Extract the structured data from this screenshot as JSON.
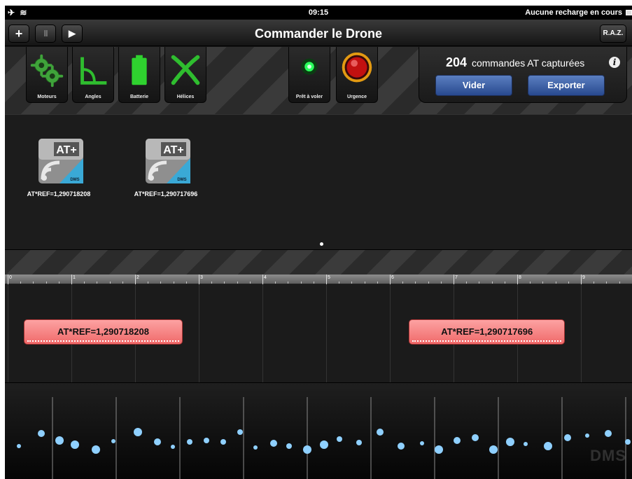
{
  "status": {
    "time": "09:15",
    "charging": "Aucune recharge en cours"
  },
  "nav": {
    "add": "+",
    "pause": "II",
    "play": "▶",
    "title": "Commander le Drone",
    "reset": "R.A.Z."
  },
  "tools": [
    {
      "label": "Moteurs",
      "icon": "gears-icon"
    },
    {
      "label": "Angles",
      "icon": "angle-icon"
    },
    {
      "label": "Batterie",
      "icon": "battery-icon"
    },
    {
      "label": "Hélices",
      "icon": "propeller-icon"
    },
    {
      "label": "Prêt à voler",
      "icon": "ready-light-icon"
    },
    {
      "label": "Urgence",
      "icon": "emergency-button-icon"
    }
  ],
  "panel": {
    "count": "204",
    "count_label": "commandes AT capturées",
    "info": "i",
    "clear": "Vider",
    "export": "Exporter"
  },
  "commands": [
    {
      "label": "AT*REF=1,290718208",
      "badge": "AT+",
      "brand": "DMS"
    },
    {
      "label": "AT*REF=1,290717696",
      "badge": "AT+",
      "brand": "DMS"
    }
  ],
  "ruler": {
    "ticks": [
      "0",
      "1",
      "2",
      "3",
      "4",
      "5",
      "6",
      "7",
      "8",
      "9"
    ]
  },
  "timeline": {
    "events": [
      {
        "label": "AT*REF=1,290718208",
        "start": 0.25,
        "end": 2.75
      },
      {
        "label": "AT*REF=1,290717696",
        "start": 6.3,
        "end": 8.75
      }
    ]
  },
  "visualizer": {
    "logo": "DMS"
  },
  "colors": {
    "accent_blue": "#3a63b0",
    "event_red": "#f48686",
    "dot_blue": "#8fd0ff",
    "ready_green": "#2bff5c"
  }
}
